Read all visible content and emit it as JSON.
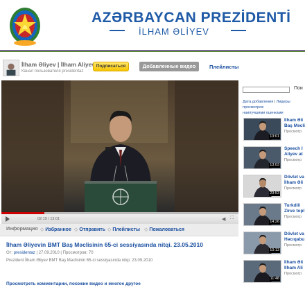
{
  "header": {
    "title": "AZƏRBAYCAN PREZİDENTİ",
    "subtitle": "İLHAM ƏLİYEV"
  },
  "channel": {
    "name": "İlham Əliyev | İlham Aliyev",
    "description": "Канал пользователя presidentaz",
    "subscribe_label": "Подписаться",
    "tab_added": "Добавленные видео",
    "tab_playlists": "Плейлисты"
  },
  "player": {
    "time": "02:19 / 13:01",
    "progress": 0.18
  },
  "actions": {
    "info": "Информация",
    "favorites": "Избранное",
    "share": "Отправить",
    "playlists": "Плейлисты",
    "report": "Пожаловаться"
  },
  "video": {
    "title": "İlham Əliyevin BMT Baş Məclisinin 65-ci sessiyasında nitqi. 23.05.2010",
    "meta_prefix": "От:",
    "meta_user": "presidentaz",
    "meta_rest": "| 27.09.2010 | Просмотров: 70",
    "description": "Prezident İlham Əliyev BMT Baş Məclisinin 65-ci sessiyasında nitqi. 23.09.2010",
    "more_link": "Просмотреть комментарии, похожие видео и многое другое"
  },
  "sidebar": {
    "search_button": "Пои",
    "links_line1": "Дата добавления",
    "links_sep": "|",
    "links_line1b": "Лидеры просмотров",
    "links_line2": "наилучшими оценками",
    "related": [
      {
        "title1": "İlham Əli",
        "title2": "Baş Məcli",
        "views": "Просмотр",
        "duration": "13:01"
      },
      {
        "title1": "Speech I",
        "title2": "Aliyev at",
        "views": "Просмотр",
        "duration": "13:03"
      },
      {
        "title1": "Dövlət va",
        "title2": "İlham Əli",
        "views": "Просмотр",
        "duration": "23:53"
      },
      {
        "title1": "Turkdili",
        "title2": "Zirve topl",
        "views": "Просмотр",
        "duration": "14:26"
      },
      {
        "title1": "Dövlət va",
        "title2": "Həcıqabu",
        "views": "Просмотр",
        "duration": "10:13"
      },
      {
        "title1": "İlham Əli",
        "title2": "Ilham Ali",
        "views": "Просмотр",
        "duration": "11:48"
      }
    ]
  },
  "colors": {
    "brand_blue": "#1f5aa6",
    "link_blue": "#1a4fa0",
    "subscribe_yellow": "#f5c400",
    "progress_red": "#cc0000"
  }
}
